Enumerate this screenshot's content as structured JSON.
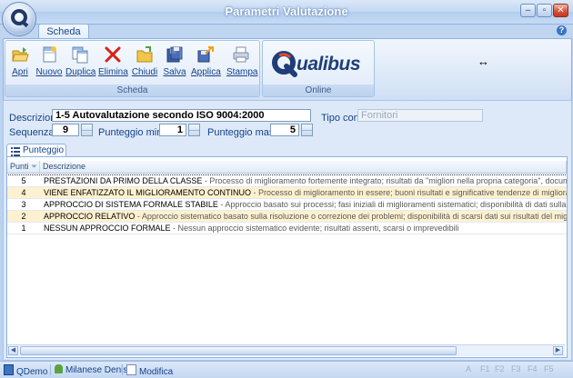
{
  "window": {
    "title": "Parametri Valutazione",
    "controls": [
      "minimize-icon",
      "restore-icon",
      "close-icon"
    ]
  },
  "ribbon": {
    "tab": "Scheda",
    "groups": [
      {
        "label": "Scheda"
      },
      {
        "label": "Online"
      }
    ],
    "buttons": [
      {
        "label": "Apri",
        "icon": "folder-open-icon"
      },
      {
        "label": "Nuovo",
        "icon": "new-document-icon"
      },
      {
        "label": "Duplica",
        "icon": "duplicate-icon"
      },
      {
        "label": "Elimina",
        "icon": "delete-x-icon"
      },
      {
        "label": "Chiudi",
        "icon": "close-folder-icon"
      },
      {
        "label": "Salva",
        "icon": "save-icon"
      },
      {
        "label": "Applica",
        "icon": "apply-icon"
      },
      {
        "label": "Stampa",
        "icon": "printer-icon"
      }
    ],
    "logo_text": "ualibus"
  },
  "form": {
    "descrizione_label": "Descrizione",
    "descrizione_value": "1-5 Autovalutazione secondo ISO 9004:2000",
    "tipo_conto_label": "Tipo conto",
    "tipo_conto_value": "Fornitori",
    "sequenza_label": "Sequenza",
    "sequenza_value": "9",
    "punteggio_minimo_label": "Punteggio minimo",
    "punteggio_minimo_value": "1",
    "punteggio_massimo_label": "Punteggio massimo",
    "punteggio_massimo_value": "5"
  },
  "grid": {
    "tab_label": "Punteggio",
    "columns": [
      "Punti",
      "Descrizione"
    ],
    "rows": [
      {
        "punti": "5",
        "title": "PRESTAZIONI DA PRIMO DELLA CLASSE",
        "detail": " - Processo di miglioramento fortemente integrato; risultati da \"migliori nella propria categoria\", documentati da benchma",
        "bg": "#ffffff"
      },
      {
        "punti": "4",
        "title": "VIENE ENFATIZZATO IL MIGLIORAMENTO CONTINUO",
        "detail": " - Processo di miglioramento in essere; buoni risultati e significative tendenze di miglioramento",
        "bg": "#fdf1cf"
      },
      {
        "punti": "3",
        "title": "APPROCCIO DI SISTEMA FORMALE STABILE",
        "detail": " - Approccio basato sui processi; fasi iniziali di miglioramenti sistematici; disponibilità di dati sulla conformità agli obie",
        "bg": "#ffffff"
      },
      {
        "punti": "2",
        "title": "APPROCCIO RELATIVO",
        "detail": " - Approccio sistematico basato sulla risoluzione o correzione dei problemi; disponibilità di scarsi dati sui risultati del miglioramento",
        "bg": "#fdf1cf"
      },
      {
        "punti": "1",
        "title": "NESSUN APPROCCIO FORMALE",
        "detail": " - Nessun approccio sistematico evidente; risultati assenti, scarsi o imprevedibili",
        "bg": "#ffffff"
      }
    ]
  },
  "statusbar": {
    "company": "QDemo",
    "user": "Milanese Denis",
    "mode": "Modifica",
    "keys": [
      "A",
      "F1",
      "F2",
      "F3",
      "F4",
      "F5"
    ]
  }
}
